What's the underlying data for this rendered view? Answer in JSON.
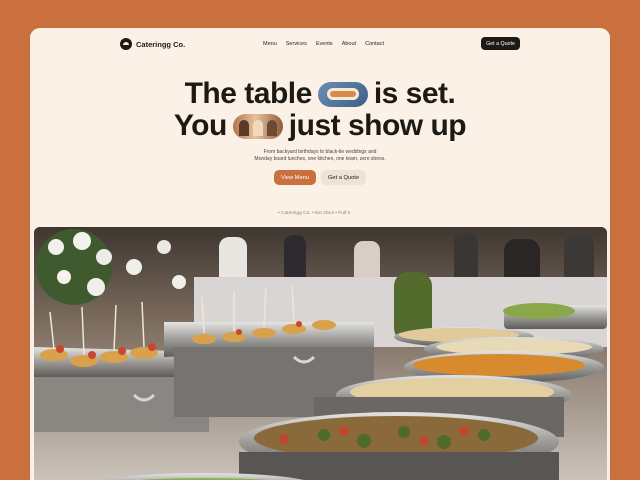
{
  "brand": {
    "name": "Cateringg Co.",
    "logo_icon": "cloche-icon"
  },
  "nav": {
    "items": [
      "Menu",
      "Services",
      "Events",
      "About",
      "Contact"
    ],
    "cta": "Get a Quote"
  },
  "hero": {
    "line1_a": "The table",
    "line1_b": "is set.",
    "line2_a": "You",
    "line2_b": "just show up",
    "subtitle_1": "From backyard birthdays to black-tie weddings and",
    "subtitle_2": "Monday board lunches, one kitchen, one team, zero stress.",
    "primary_cta": "View Menu",
    "secondary_cta": "Get a Quote"
  },
  "marquee": {
    "text": "• Cateringg Co. • Est 2014 • Full S"
  },
  "colors": {
    "page_bg": "#c9703e",
    "card_bg": "#fbf1e6",
    "accent": "#c9703e",
    "ink": "#1d1a16"
  }
}
